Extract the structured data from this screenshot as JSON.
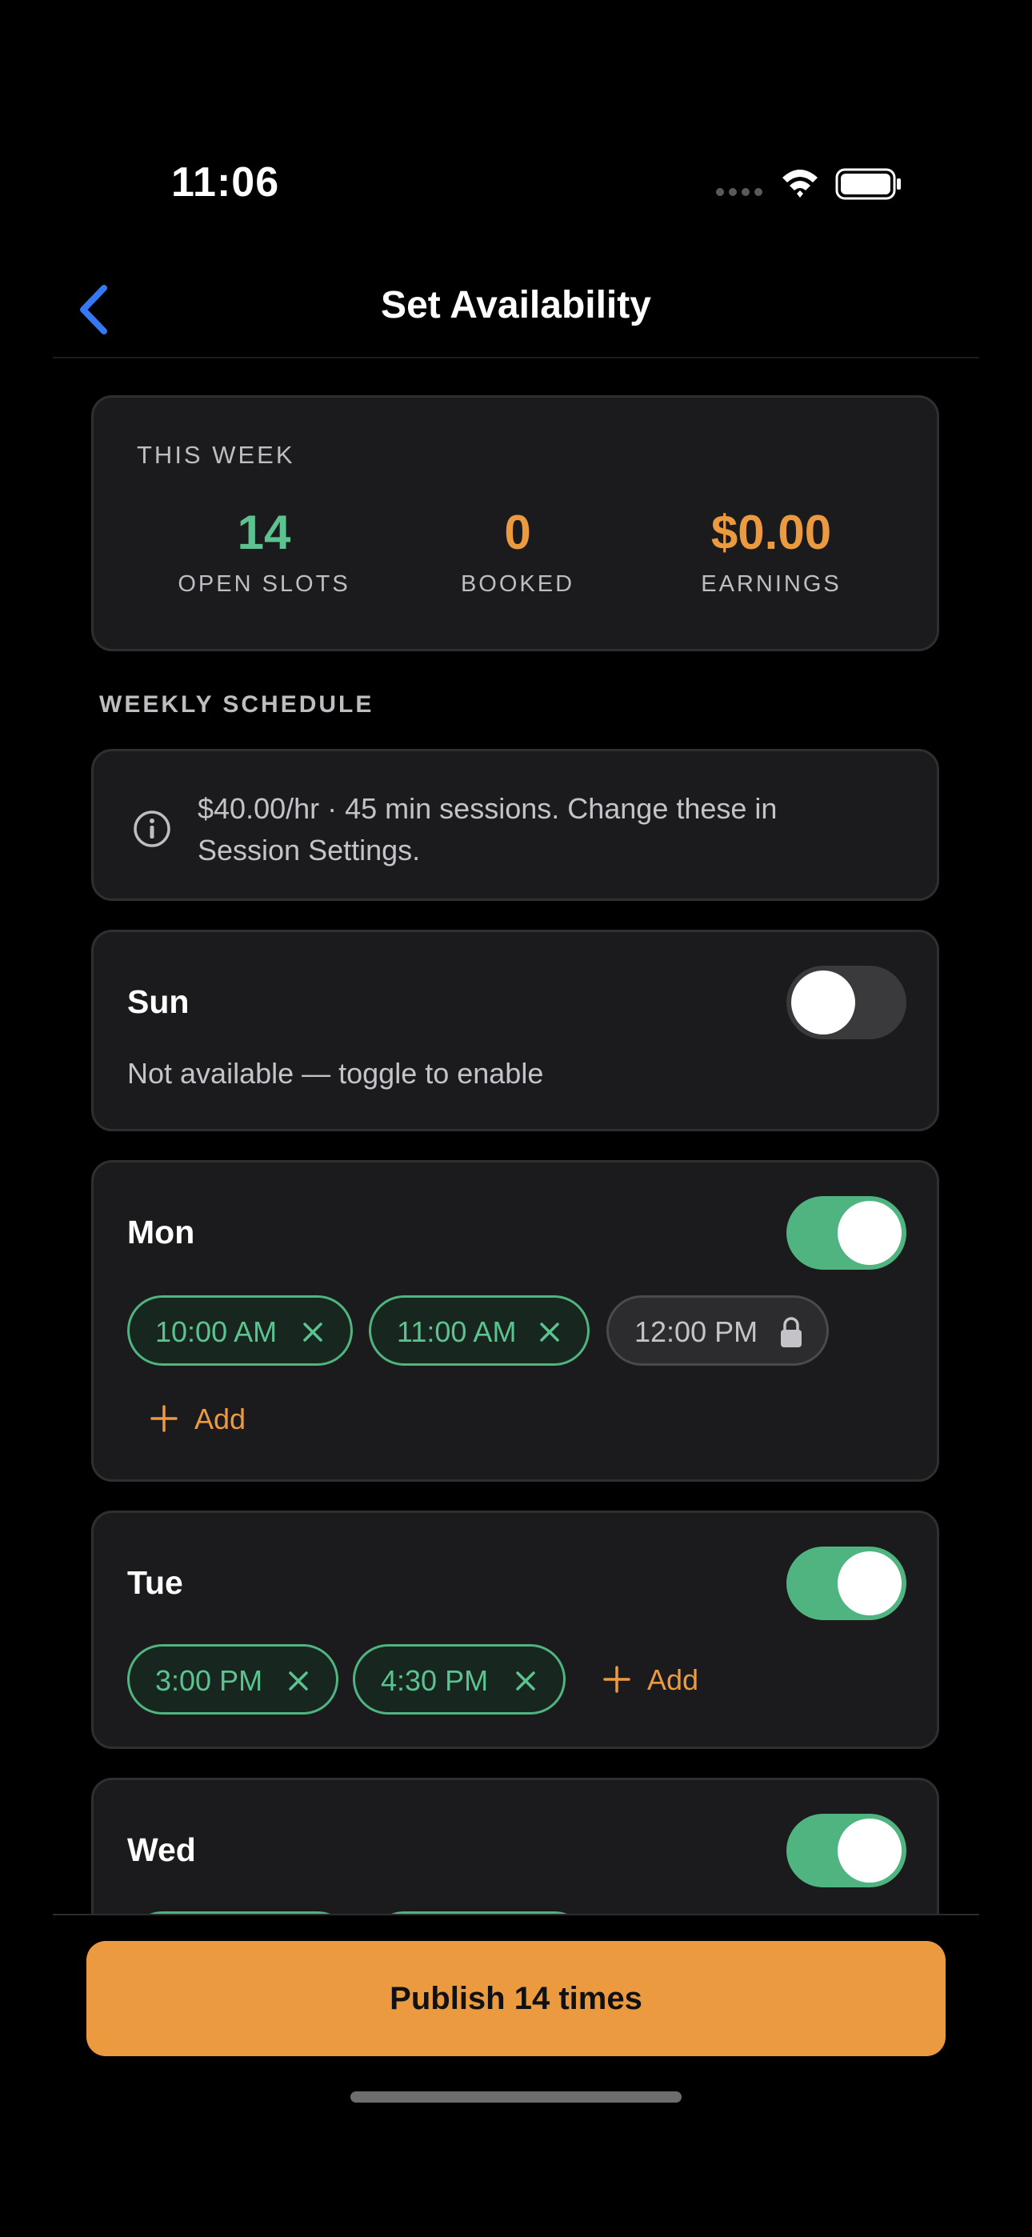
{
  "status_bar": {
    "time": "11:06"
  },
  "nav": {
    "title": "Set Availability"
  },
  "summary": {
    "heading": "THIS WEEK",
    "stats": [
      {
        "value": "14",
        "label": "OPEN SLOTS",
        "color": "#5cc28f"
      },
      {
        "value": "0",
        "label": "BOOKED",
        "color": "#ec9a3f"
      },
      {
        "value": "$0.00",
        "label": "EARNINGS",
        "color": "#ec9a3f"
      }
    ]
  },
  "schedule": {
    "heading": "WEEKLY SCHEDULE",
    "info_text": "$40.00/hr · 45 min sessions. Change these in Session Settings.",
    "days": [
      {
        "name": "Sun",
        "enabled": false,
        "note": "Not available — toggle to enable"
      },
      {
        "name": "Mon",
        "enabled": true,
        "slots": [
          "10:00 AM",
          "11:00 AM"
        ],
        "locked_slots": [
          "12:00 PM"
        ],
        "add_label": "Add"
      },
      {
        "name": "Tue",
        "enabled": true,
        "slots": [
          "3:00 PM",
          "4:30 PM"
        ],
        "add_label": "Add"
      },
      {
        "name": "Wed",
        "enabled": true
      }
    ]
  },
  "footer": {
    "publish_label": "Publish 14 times"
  },
  "colors": {
    "accent_orange": "#ec9a3f",
    "accent_green": "#4fb47f",
    "ios_blue": "#3478f6"
  }
}
